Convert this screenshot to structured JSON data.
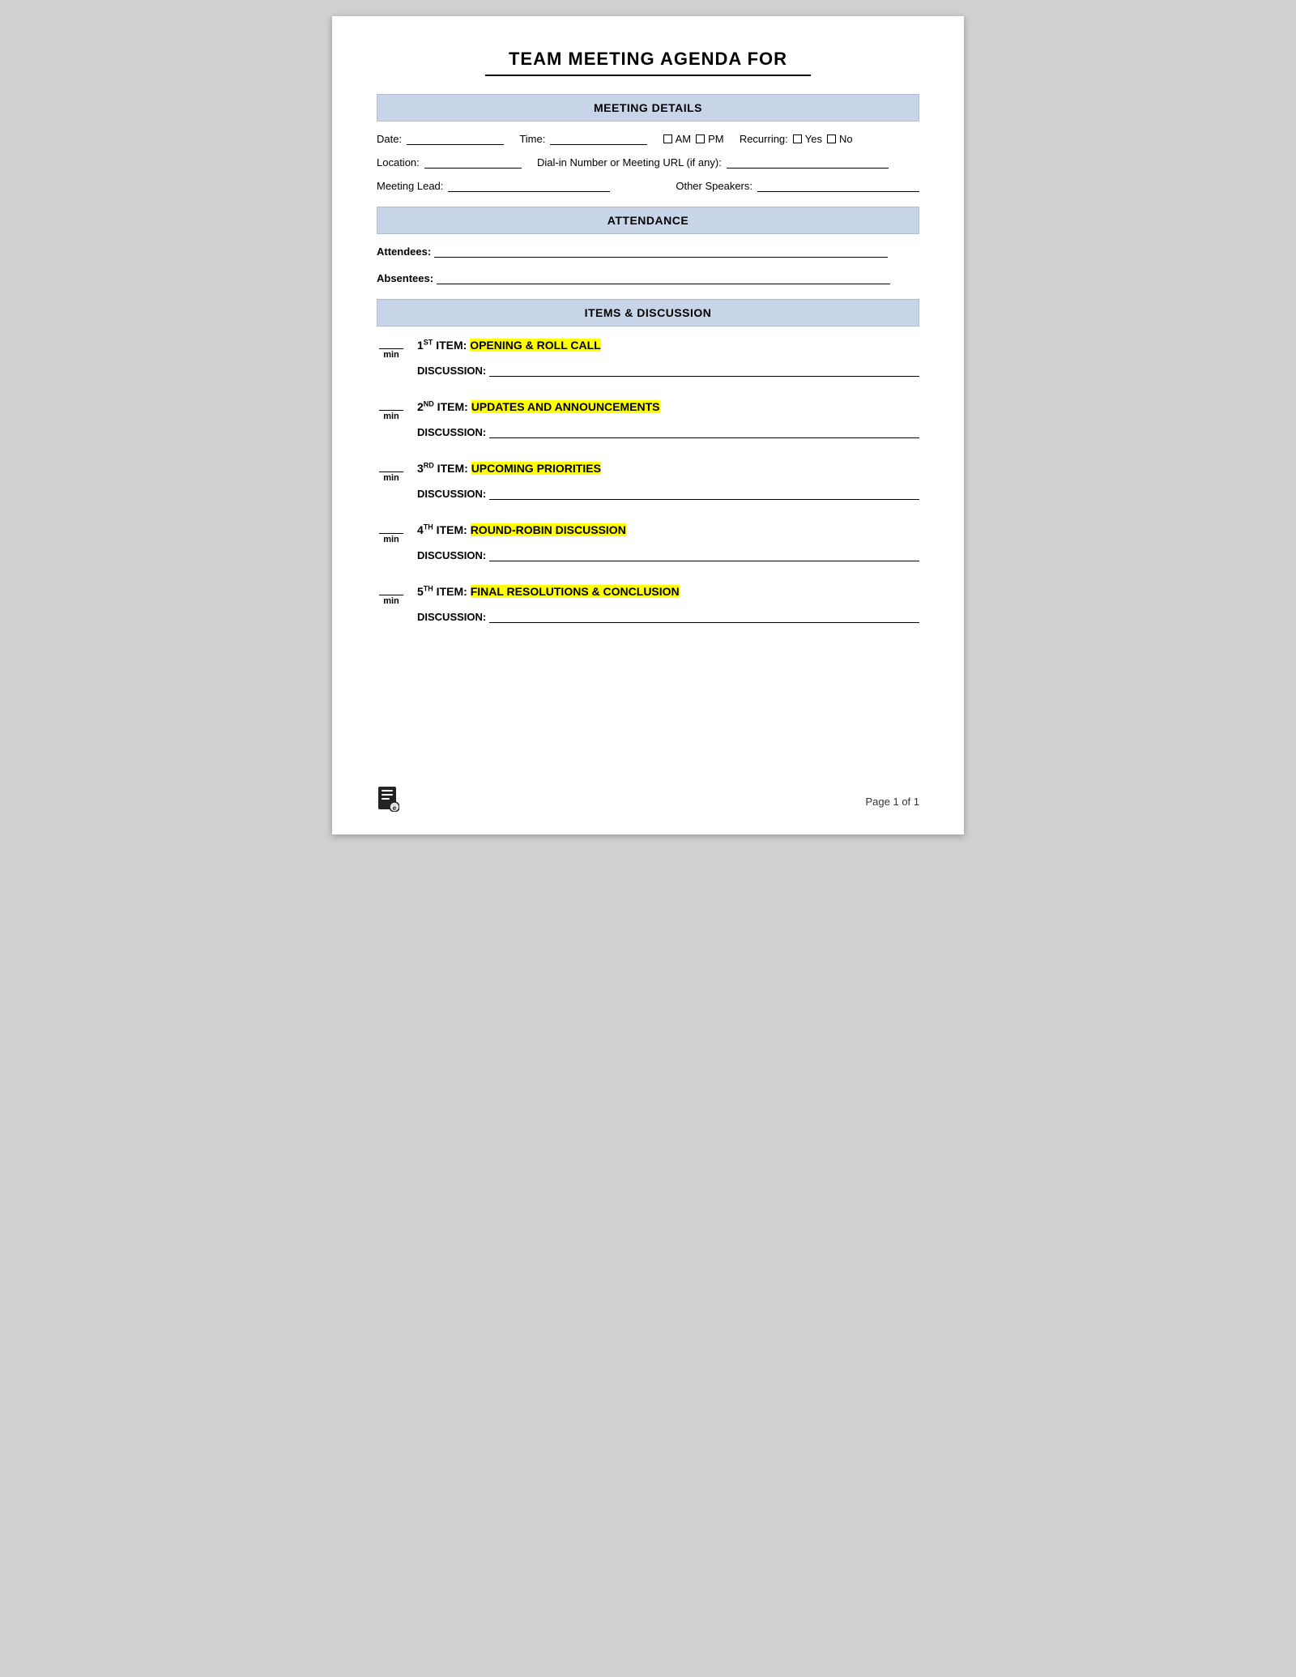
{
  "title": "TEAM MEETING AGENDA FOR",
  "sections": {
    "meeting_details": {
      "header": "MEETING DETAILS",
      "date_label": "Date:",
      "time_label": "Time:",
      "am_label": "AM",
      "pm_label": "PM",
      "recurring_label": "Recurring:",
      "yes_label": "Yes",
      "no_label": "No",
      "location_label": "Location:",
      "dialin_label": "Dial-in Number or Meeting URL (if any):",
      "meeting_lead_label": "Meeting Lead:",
      "other_speakers_label": "Other Speakers:"
    },
    "attendance": {
      "header": "ATTENDANCE",
      "attendees_label": "Attendees:",
      "absentees_label": "Absentees:"
    },
    "items": {
      "header": "ITEMS & DISCUSSION",
      "agenda_items": [
        {
          "number": "1",
          "ordinal": "ST",
          "title": "ITEM: ",
          "highlight": "OPENING & ROLL CALL",
          "discussion_label": "DISCUSSION:"
        },
        {
          "number": "2",
          "ordinal": "ND",
          "title": "ITEM: ",
          "highlight": "UPDATES AND ANNOUNCEMENTS",
          "discussion_label": "DISCUSSION:"
        },
        {
          "number": "3",
          "ordinal": "RD",
          "title": "ITEM: ",
          "highlight": "UPCOMING PRIORITIES",
          "discussion_label": "DISCUSSION:"
        },
        {
          "number": "4",
          "ordinal": "TH",
          "title": "ITEM: ",
          "highlight": "ROUND-ROBIN DISCUSSION",
          "discussion_label": "DISCUSSION:"
        },
        {
          "number": "5",
          "ordinal": "TH",
          "title": "ITEM: ",
          "highlight": "FINAL RESOLUTIONS & CONCLUSION",
          "discussion_label": "DISCUSSION:"
        }
      ]
    }
  },
  "footer": {
    "page_text": "Page 1 of 1"
  }
}
